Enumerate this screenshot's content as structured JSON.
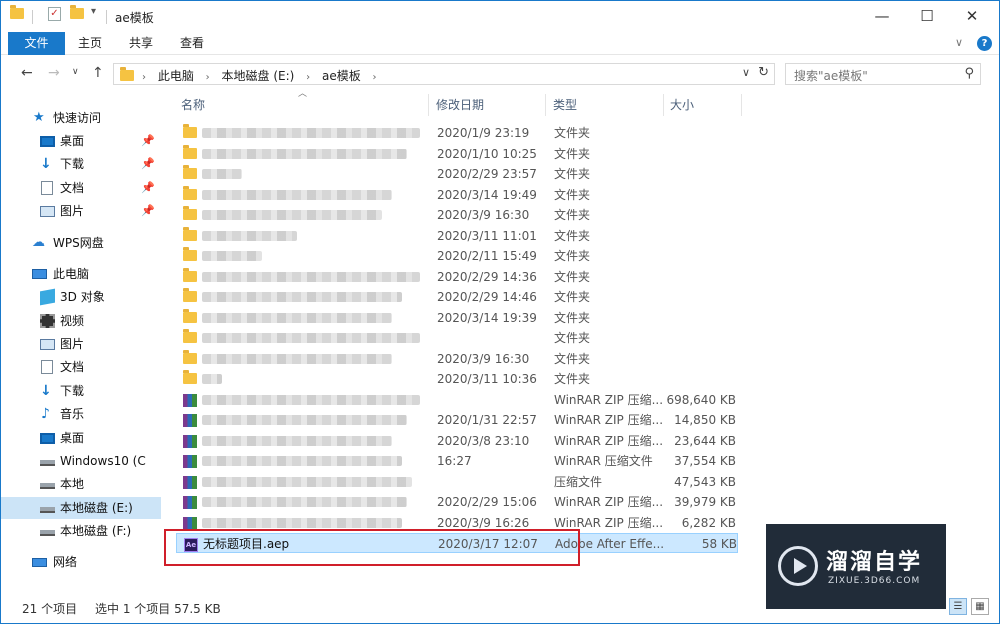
{
  "window": {
    "title": "ae模板",
    "minimize": "—",
    "maximize": "☐",
    "close": "✕"
  },
  "ribbon": {
    "tabs": [
      "文件",
      "主页",
      "共享",
      "查看"
    ],
    "expand": "∨",
    "help": "?"
  },
  "address": {
    "crumbs": [
      "此电脑",
      "本地磁盘 (E:)",
      "ae模板"
    ],
    "search_placeholder": "搜索\"ae模板\""
  },
  "nav": {
    "quick_access": "快速访问",
    "quick_items": [
      "桌面",
      "下载",
      "文档",
      "图片"
    ],
    "wps": "WPS网盘",
    "this_pc": "此电脑",
    "pc_items": [
      "3D 对象",
      "视频",
      "图片",
      "文档",
      "下载",
      "音乐",
      "桌面",
      "Windows10 (C",
      "本地",
      "本地磁盘 (E:)",
      "本地磁盘 (F:)"
    ],
    "network": "网络"
  },
  "columns": {
    "name": "名称",
    "date": "修改日期",
    "type": "类型",
    "size": "大小"
  },
  "files": [
    {
      "date": "2020/1/9 23:19",
      "type": "文件夹",
      "size": "",
      "kind": "folder",
      "blur": 218
    },
    {
      "date": "2020/1/10 10:25",
      "type": "文件夹",
      "size": "",
      "kind": "folder",
      "blur": 205
    },
    {
      "date": "2020/2/29 23:57",
      "type": "文件夹",
      "size": "",
      "kind": "folder",
      "blur": 40
    },
    {
      "date": "2020/3/14 19:49",
      "type": "文件夹",
      "size": "",
      "kind": "folder",
      "blur": 190
    },
    {
      "date": "2020/3/9 16:30",
      "type": "文件夹",
      "size": "",
      "kind": "folder",
      "blur": 180
    },
    {
      "date": "2020/3/11 11:01",
      "type": "文件夹",
      "size": "",
      "kind": "folder",
      "blur": 95
    },
    {
      "date": "2020/2/11 15:49",
      "type": "文件夹",
      "size": "",
      "kind": "folder",
      "blur": 60
    },
    {
      "date": "2020/2/29 14:36",
      "type": "文件夹",
      "size": "",
      "kind": "folder",
      "blur": 218
    },
    {
      "date": "2020/2/29 14:46",
      "type": "文件夹",
      "size": "",
      "kind": "folder",
      "blur": 200
    },
    {
      "date": "2020/3/14 19:39",
      "type": "文件夹",
      "size": "",
      "kind": "folder",
      "blur": 190
    },
    {
      "date": "",
      "type": "文件夹",
      "size": "",
      "kind": "folder",
      "blur": 218
    },
    {
      "date": "2020/3/9 16:30",
      "type": "文件夹",
      "size": "",
      "kind": "folder",
      "blur": 190
    },
    {
      "date": "2020/3/11 10:36",
      "type": "文件夹",
      "size": "",
      "kind": "folder",
      "blur": 20
    },
    {
      "date": "",
      "type": "WinRAR ZIP 压缩...",
      "size": "698,640 KB",
      "kind": "rar",
      "blur": 218
    },
    {
      "date": "2020/1/31 22:57",
      "type": "WinRAR ZIP 压缩...",
      "size": "14,850 KB",
      "kind": "rar",
      "blur": 205
    },
    {
      "date": "2020/3/8 23:10",
      "type": "WinRAR ZIP 压缩...",
      "size": "23,644 KB",
      "kind": "rar",
      "blur": 190
    },
    {
      "date": "16:27",
      "type": "WinRAR 压缩文件",
      "size": "37,554 KB",
      "kind": "rar",
      "blur": 200
    },
    {
      "date": "",
      "type": "压缩文件",
      "size": "47,543 KB",
      "kind": "rar",
      "blur": 210
    },
    {
      "date": "2020/2/29 15:06",
      "type": "WinRAR ZIP 压缩...",
      "size": "39,979 KB",
      "kind": "rar",
      "blur": 205
    },
    {
      "date": "2020/3/9 16:26",
      "type": "WinRAR ZIP 压缩...",
      "size": "6,282 KB",
      "kind": "rar",
      "blur": 200
    },
    {
      "name": "无标题项目.aep",
      "date": "2020/3/17 12:07",
      "type": "Adobe After Effe...",
      "size": "58 KB",
      "kind": "aep",
      "selected": true
    }
  ],
  "status": {
    "count": "21 个项目",
    "selection": "选中 1 个项目  57.5 KB"
  },
  "watermark": {
    "title": "溜溜自学",
    "url": "ZIXUE.3D66.COM"
  },
  "colors": {
    "accent": "#1979ca",
    "selected_row": "#cce8ff",
    "highlight_box": "#d01f2a"
  }
}
